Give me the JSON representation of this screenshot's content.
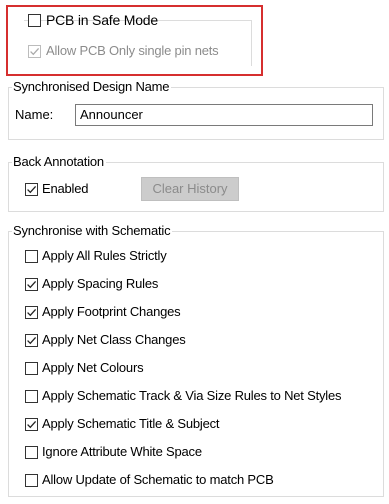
{
  "safe_mode": {
    "pcb_safe_mode_label": "PCB in Safe Mode",
    "pcb_safe_mode_checked": false,
    "allow_single_pin_label": "Allow PCB Only single pin nets",
    "allow_single_pin_checked": true,
    "allow_single_pin_disabled": true
  },
  "synchronised_design_name": {
    "title": "Synchronised Design Name",
    "name_label": "Name:",
    "name_value": "Announcer"
  },
  "back_annotation": {
    "title": "Back Annotation",
    "enabled_label": "Enabled",
    "enabled_checked": true,
    "clear_history_label": "Clear History"
  },
  "synchronise_with_schematic": {
    "title": "Synchronise with Schematic",
    "items": [
      {
        "label": "Apply All Rules Strictly",
        "checked": false
      },
      {
        "label": "Apply Spacing Rules",
        "checked": true
      },
      {
        "label": "Apply Footprint Changes",
        "checked": true
      },
      {
        "label": "Apply Net Class Changes",
        "checked": true
      },
      {
        "label": "Apply Net Colours",
        "checked": false
      },
      {
        "label": "Apply Schematic Track & Via Size Rules to Net Styles",
        "checked": false
      },
      {
        "label": "Apply Schematic Title & Subject",
        "checked": true
      },
      {
        "label": "Ignore Attribute White Space",
        "checked": false
      },
      {
        "label": "Allow Update of Schematic to match PCB",
        "checked": false
      }
    ]
  }
}
